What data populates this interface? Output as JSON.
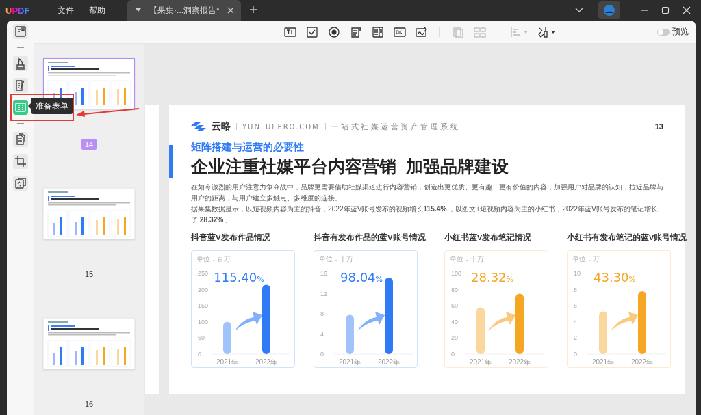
{
  "app": {
    "logo": "UPDF",
    "menus": [
      "文件",
      "帮助"
    ]
  },
  "tabs": [
    {
      "label": "【果集·...洞察报告*",
      "selected": true
    }
  ],
  "rail": {
    "groups": [
      [
        {
          "kind": "reader",
          "selected": false
        }
      ],
      [
        {
          "kind": "highlighter",
          "selected": false
        },
        {
          "kind": "edit",
          "selected": false
        },
        {
          "kind": "form",
          "selected": true
        }
      ],
      [
        {
          "kind": "pages",
          "selected": false
        },
        {
          "kind": "crop",
          "selected": false
        },
        {
          "kind": "convert",
          "selected": false
        }
      ]
    ],
    "tooltip": "准备表单"
  },
  "toolbar": {
    "groups": [
      [
        {
          "kind": "text-field",
          "disabled": false
        },
        {
          "kind": "checkbox",
          "disabled": false
        },
        {
          "kind": "radio",
          "disabled": false
        },
        {
          "kind": "list-box",
          "disabled": false
        },
        {
          "kind": "dropdown",
          "disabled": false
        },
        {
          "kind": "button",
          "disabled": false
        },
        {
          "kind": "signature",
          "disabled": false
        }
      ],
      [
        {
          "kind": "duplicate",
          "disabled": true
        },
        {
          "kind": "grid",
          "disabled": true
        }
      ],
      [
        {
          "kind": "align",
          "disabled": true
        },
        {
          "kind": "tools",
          "disabled": false
        }
      ]
    ],
    "preview": {
      "label": "预览",
      "on": false
    }
  },
  "thumbnails": [
    {
      "page": "14",
      "selected": true
    },
    {
      "page": "15",
      "selected": false
    },
    {
      "page": "16",
      "selected": false
    }
  ],
  "document": {
    "brand": "云略",
    "site": "YUNLUEPRO.COM",
    "slogan": "一站式社媒运营资产管理系统",
    "page_number": "13",
    "subtitle": "矩阵搭建与运营的必要性",
    "title": "企业注重社媒平台内容营销  加强品牌建设",
    "paragraphs": [
      "在如今激烈的用户注意力争夺战中，品牌更需要借助社媒渠道进行内容营销，创造出更优质、更有趣、更有价值的内容，加强用户对品牌的认知，拉近品牌与用户的距离，与用户建立多触点、多维度的连接。",
      "据果集数据显示，以短视频内容为主的抖音，2022年蓝V账号发布的视频增长**115.4%** ，以图文+短视频内容为主的小红书，2022年蓝V账号发布的笔记增长了 **28.32%** 。"
    ],
    "charts": [
      {
        "title": "抖音蓝V发布作品情况",
        "unit": "单位：百万",
        "growth": "115.40",
        "growth_unit": "%",
        "color": "#2f7bf6",
        "chart_data": {
          "type": "bar",
          "categories": [
            "2021年",
            "2022年"
          ],
          "values": [
            100,
            215
          ],
          "ylim": [
            0,
            250
          ],
          "yticks": [
            0,
            50,
            100,
            150,
            200,
            250
          ]
        }
      },
      {
        "title": "抖音有发布作品的蓝V账号情况",
        "unit": "单位：十万",
        "growth": "98.04",
        "growth_unit": "%",
        "color": "#2f7bf6",
        "chart_data": {
          "type": "bar",
          "categories": [
            "2021年",
            "2022年"
          ],
          "values": [
            7.8,
            15.2
          ],
          "ylim": [
            0,
            16
          ],
          "yticks": [
            0,
            4,
            8,
            12,
            16
          ]
        }
      },
      {
        "title": "小红书蓝V发布笔记情况",
        "unit": "单位：十万",
        "growth": "28.32",
        "growth_unit": "%",
        "color": "#f5a623",
        "chart_data": {
          "type": "bar",
          "categories": [
            "2021年",
            "2022年"
          ],
          "values": [
            58,
            75
          ],
          "ylim": [
            0,
            100
          ],
          "yticks": [
            0,
            20,
            40,
            60,
            80,
            100
          ]
        }
      },
      {
        "title": "小红书有发布笔记的蓝V账号情况",
        "unit": "单位：万",
        "growth": "43.30",
        "growth_unit": "%",
        "color": "#f5a623",
        "chart_data": {
          "type": "bar",
          "categories": [
            "2021年",
            "2022年"
          ],
          "values": [
            5.3,
            7.8
          ],
          "ylim": [
            0,
            10
          ],
          "yticks": [
            0,
            2,
            4,
            6,
            8,
            10
          ]
        }
      }
    ]
  }
}
